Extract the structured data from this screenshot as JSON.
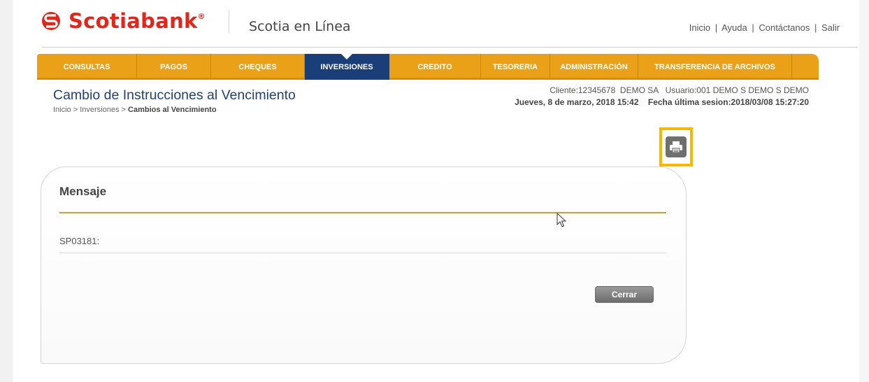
{
  "header": {
    "brand": "Scotiabank",
    "brand_mark": "®",
    "product": "Scotia en Línea",
    "links": [
      "Inicio",
      "Ayuda",
      "Contáctanos",
      "Salir"
    ],
    "link_separator": "|",
    "brand_color": "#e1261c"
  },
  "nav": {
    "items": [
      "CONSULTAS",
      "PAGOS",
      "CHEQUES",
      "INVERSIONES",
      "CREDITO",
      "TESORERIA",
      "ADMINISTRACIÓN",
      "TRANSFERENCIA DE ARCHIVOS"
    ],
    "active": "INVERSIONES",
    "color": "#eaa118",
    "active_color": "#1a3f78"
  },
  "page": {
    "title": "Cambio de Instrucciones al Vencimiento",
    "breadcrumb_prefix": "Inicio > Inversiones > ",
    "breadcrumb_current": "Cambios al Vencimiento",
    "client_info": "Cliente:12345678  DEMO SA   Usuario:001 DEMO S DEMO S DEMO",
    "session_info": "Jueves, 8 de marzo, 2018 15:42    Fecha última sesion:2018/03/08 15:27:20"
  },
  "toolbar": {
    "print_icon": "printer-icon"
  },
  "message": {
    "heading": "Mensaje",
    "code": "SP03181:",
    "close_label": "Cerrar"
  }
}
